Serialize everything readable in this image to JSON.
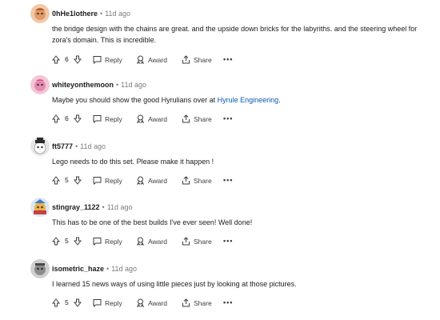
{
  "labels": {
    "reply": "Reply",
    "award": "Award",
    "share": "Share",
    "more": "•••",
    "dot": "•"
  },
  "comments": [
    {
      "author": "0hHe1lothere",
      "time": "11d ago",
      "text": "the bridge design with the chains are great. and the upside down bricks for the labyriths. and the steering wheel for zora's domain. This is incredible.",
      "votes": "6",
      "avatar": "snoo-orange"
    },
    {
      "author": "whiteyonthemoon",
      "time": "11d ago",
      "text_before_link": "Maybe you should show the good Hyrulians over at ",
      "link": "Hyrule Engineering",
      "text_after_link": ".",
      "votes": "6",
      "avatar": "snoo-pink"
    },
    {
      "author": "ft5777",
      "time": "11d ago",
      "text": "Lego needs to do this set. Please make it happen !",
      "votes": "5",
      "avatar": "snoo-white-hat"
    },
    {
      "author": "stingray_1122",
      "time": "11d ago",
      "text": "This has to be one of the best builds I've ever seen! Well done!",
      "votes": "5",
      "avatar": "snoo-colorful"
    },
    {
      "author": "isometric_haze",
      "time": "11d ago",
      "text": "I learned 15 news ways of using little pieces just by looking at those pictures.",
      "votes": "5",
      "avatar": "snoo-gray"
    }
  ]
}
